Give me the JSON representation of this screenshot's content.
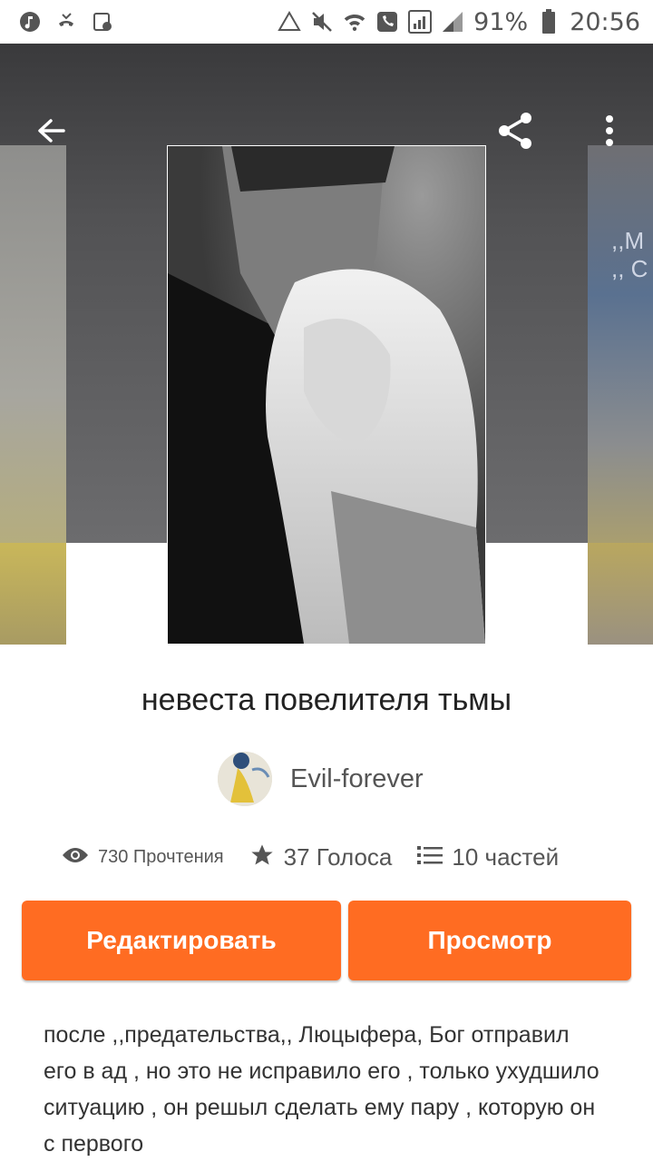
{
  "status_bar": {
    "battery": "91%",
    "time": "20:56",
    "left_icons": [
      "music-note-icon",
      "missed-call-icon",
      "screenshot-icon"
    ],
    "right_icons": [
      "recycle-icon",
      "mute-icon",
      "wifi-call-icon",
      "phone-icon",
      "signal-icon",
      "signal-2-icon",
      "battery-icon"
    ]
  },
  "toolbar": {
    "back_icon": "arrow-left-icon",
    "share_icon": "share-icon",
    "more_icon": "more-vert-icon"
  },
  "adjacent_cover_text": ",,M ,, C",
  "story": {
    "title": "невеста повелителя тьмы",
    "author": "Evil-forever",
    "reads": "730 Прочтения",
    "votes": "37 Голоса",
    "parts": "10 частей",
    "description": "после ,,предательства,, Люцыфера, Бог отправил его в ад , но это не исправило его , только ухудшило ситуацию , он решыл сделать ему пару , которую он с первого"
  },
  "buttons": {
    "edit_label": "Редактировать",
    "view_label": "Просмотр"
  },
  "colors": {
    "accent": "#ff6c22",
    "hero_bg": "#4a4a4c"
  }
}
